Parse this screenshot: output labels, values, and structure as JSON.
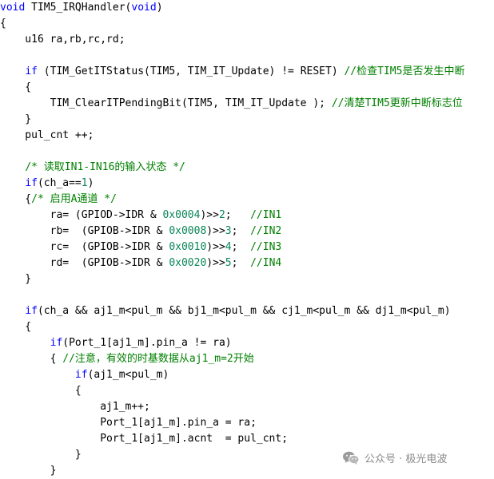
{
  "colors": {
    "keyword": "#0000ff",
    "comment": "#008000",
    "number": "#098658",
    "text": "#000000",
    "watermark": "#8a8a8a"
  },
  "code_lines": [
    [
      {
        "t": "void",
        "c": "kw"
      },
      {
        "t": " TIM5_IRQHandler(",
        "c": "txt"
      },
      {
        "t": "void",
        "c": "kw"
      },
      {
        "t": ")",
        "c": "txt"
      }
    ],
    [
      {
        "t": "{",
        "c": "txt"
      }
    ],
    [
      {
        "t": "    u16 ra,rb,rc,rd;",
        "c": "txt"
      }
    ],
    [],
    [
      {
        "t": "    ",
        "c": "txt"
      },
      {
        "t": "if",
        "c": "kw"
      },
      {
        "t": " (TIM_GetITStatus(TIM5, TIM_IT_Update) != RESET) ",
        "c": "txt"
      },
      {
        "t": "//检查TIM5是否发生中断",
        "c": "cm"
      }
    ],
    [
      {
        "t": "    {",
        "c": "txt"
      }
    ],
    [
      {
        "t": "        TIM_ClearITPendingBit(TIM5, TIM_IT_Update ); ",
        "c": "txt"
      },
      {
        "t": "//清楚TIM5更新中断标志位",
        "c": "cm"
      }
    ],
    [
      {
        "t": "    }",
        "c": "txt"
      }
    ],
    [
      {
        "t": "    pul_cnt ++;",
        "c": "txt"
      }
    ],
    [],
    [
      {
        "t": "    ",
        "c": "txt"
      },
      {
        "t": "/* 读取IN1-IN16的输入状态 */",
        "c": "cm"
      }
    ],
    [
      {
        "t": "    ",
        "c": "txt"
      },
      {
        "t": "if",
        "c": "kw"
      },
      {
        "t": "(ch_a==",
        "c": "txt"
      },
      {
        "t": "1",
        "c": "num"
      },
      {
        "t": ")",
        "c": "txt"
      }
    ],
    [
      {
        "t": "    {",
        "c": "txt"
      },
      {
        "t": "/* 启用A通道 */",
        "c": "cm"
      }
    ],
    [
      {
        "t": "        ra= (GPIOD->IDR & ",
        "c": "txt"
      },
      {
        "t": "0x0004",
        "c": "num"
      },
      {
        "t": ")>>",
        "c": "txt"
      },
      {
        "t": "2",
        "c": "num"
      },
      {
        "t": ";   ",
        "c": "txt"
      },
      {
        "t": "//IN1",
        "c": "cm"
      }
    ],
    [
      {
        "t": "        rb=  (GPIOB->IDR & ",
        "c": "txt"
      },
      {
        "t": "0x0008",
        "c": "num"
      },
      {
        "t": ")>>",
        "c": "txt"
      },
      {
        "t": "3",
        "c": "num"
      },
      {
        "t": ";  ",
        "c": "txt"
      },
      {
        "t": "//IN2",
        "c": "cm"
      }
    ],
    [
      {
        "t": "        rc=  (GPIOB->IDR & ",
        "c": "txt"
      },
      {
        "t": "0x0010",
        "c": "num"
      },
      {
        "t": ")>>",
        "c": "txt"
      },
      {
        "t": "4",
        "c": "num"
      },
      {
        "t": ";  ",
        "c": "txt"
      },
      {
        "t": "//IN3",
        "c": "cm"
      }
    ],
    [
      {
        "t": "        rd=  (GPIOB->IDR & ",
        "c": "txt"
      },
      {
        "t": "0x0020",
        "c": "num"
      },
      {
        "t": ")>>",
        "c": "txt"
      },
      {
        "t": "5",
        "c": "num"
      },
      {
        "t": ";  ",
        "c": "txt"
      },
      {
        "t": "//IN4",
        "c": "cm"
      }
    ],
    [
      {
        "t": "    }",
        "c": "txt"
      }
    ],
    [],
    [
      {
        "t": "    ",
        "c": "txt"
      },
      {
        "t": "if",
        "c": "kw"
      },
      {
        "t": "(ch_a && aj1_m<pul_m && bj1_m<pul_m && cj1_m<pul_m && dj1_m<pul_m)",
        "c": "txt"
      }
    ],
    [
      {
        "t": "    {",
        "c": "txt"
      }
    ],
    [
      {
        "t": "        ",
        "c": "txt"
      },
      {
        "t": "if",
        "c": "kw"
      },
      {
        "t": "(Port_1[aj1_m].pin_a != ra)",
        "c": "txt"
      }
    ],
    [
      {
        "t": "        { ",
        "c": "txt"
      },
      {
        "t": "//注意，有效的时基数据从aj1_m=2开始",
        "c": "cm"
      }
    ],
    [
      {
        "t": "            ",
        "c": "txt"
      },
      {
        "t": "if",
        "c": "kw"
      },
      {
        "t": "(aj1_m<pul_m)",
        "c": "txt"
      }
    ],
    [
      {
        "t": "            {",
        "c": "txt"
      }
    ],
    [
      {
        "t": "                aj1_m++;",
        "c": "txt"
      }
    ],
    [
      {
        "t": "                Port_1[aj1_m].pin_a = ra;",
        "c": "txt"
      }
    ],
    [
      {
        "t": "                Port_1[aj1_m].acnt  = pul_cnt;",
        "c": "txt"
      }
    ],
    [
      {
        "t": "            }",
        "c": "txt"
      }
    ],
    [
      {
        "t": "        }",
        "c": "txt"
      }
    ]
  ],
  "watermark": {
    "icon": "wechat-icon",
    "text": "公众号 · 极光电波"
  }
}
